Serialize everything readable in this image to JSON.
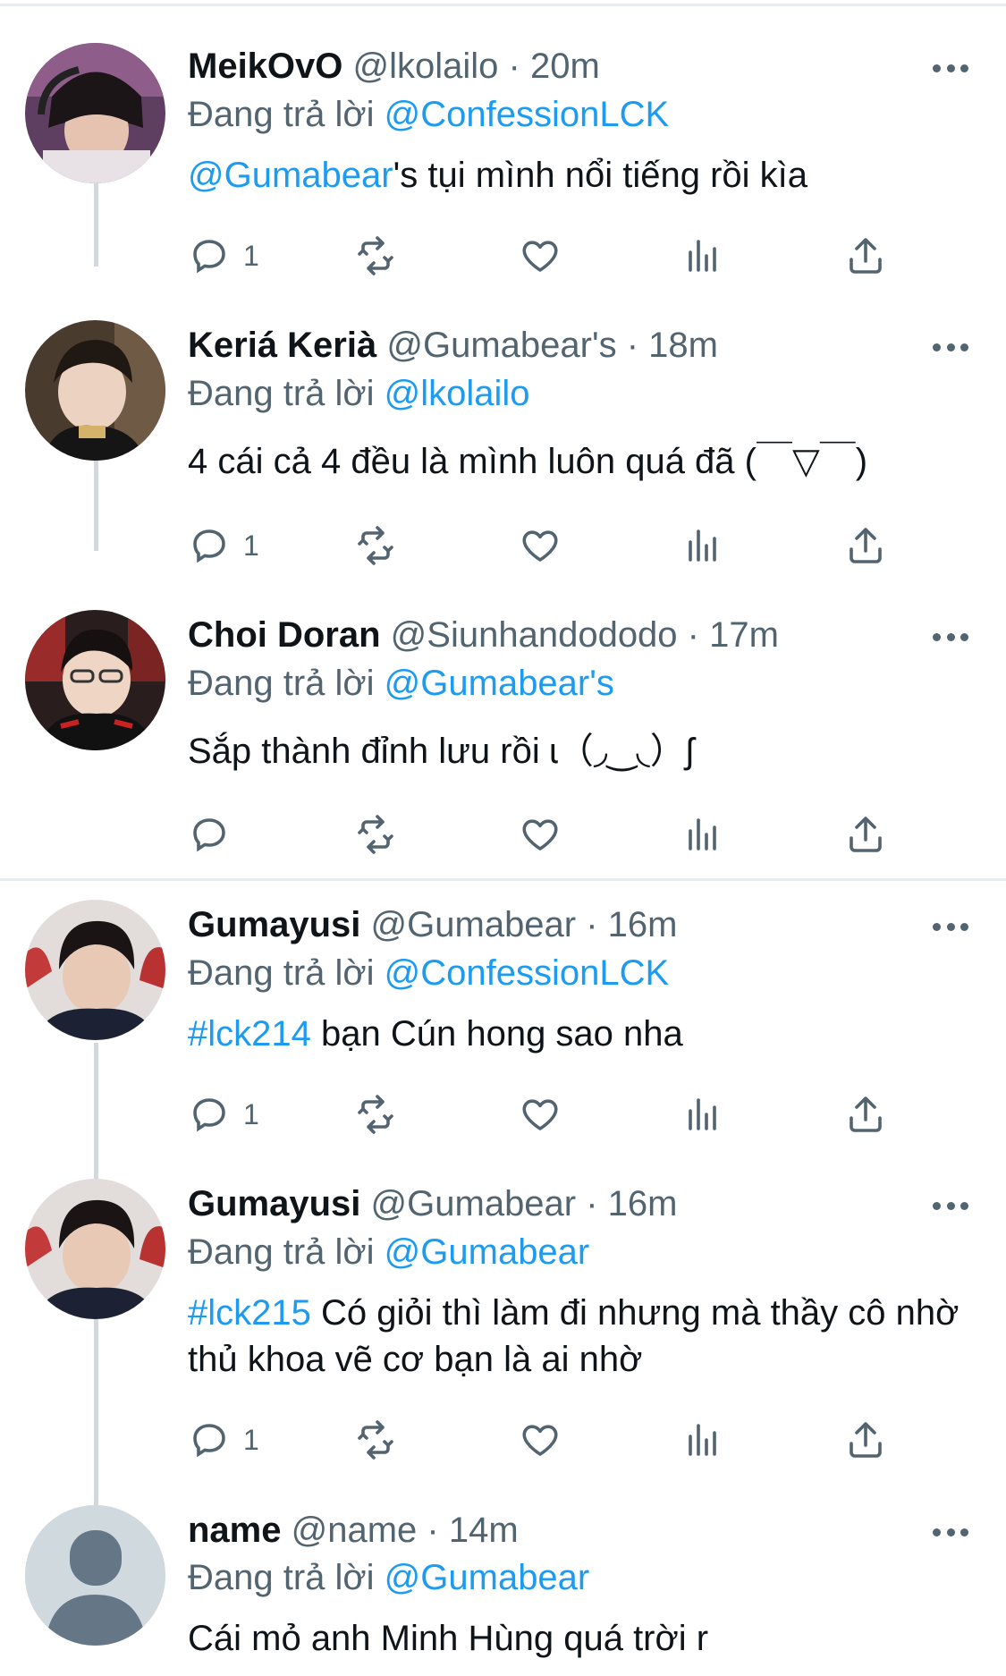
{
  "tweets": [
    {
      "name": "MeikOvO",
      "handle": "@lkolailo",
      "sep": " · ",
      "time": "20m",
      "reply_prefix": "Đang trả lời ",
      "reply_to": "@ConfessionLCK",
      "text_link": "@Gumabear",
      "text": "'s tụi mình nổi tiếng rồi kìa",
      "reply_count": "1",
      "avatar_bg": "#7a4a6a"
    },
    {
      "name": "Keriá Kerià",
      "handle": "@Gumabear's",
      "sep": " · ",
      "time": "18m",
      "reply_prefix": "Đang trả lời ",
      "reply_to": "@lkolailo",
      "text_link": "",
      "text": "4 cái cả 4 đều là mình luôn quá đã (￣▽￣)",
      "reply_count": "1",
      "avatar_bg": "#5a4a3e"
    },
    {
      "name": "Choi Doran",
      "handle": "@Siunhandododo",
      "sep": " · ",
      "time": "17m",
      "reply_prefix": "Đang trả lời ",
      "reply_to": "@Gumabear's",
      "text_link": "",
      "text": "Sắp thành đỉnh lưu rồi ɩ（◞‿◟）ʃ",
      "reply_count": "",
      "avatar_bg": "#8a2a2a"
    },
    {
      "name": "Gumayusi",
      "handle": "@Gumabear",
      "sep": " · ",
      "time": "16m",
      "reply_prefix": "Đang trả lời ",
      "reply_to": "@ConfessionLCK",
      "text_link": "#lck214",
      "text": " bạn Cún hong sao nha",
      "reply_count": "1",
      "avatar_bg": "#c9c2c0"
    },
    {
      "name": "Gumayusi",
      "handle": "@Gumabear",
      "sep": " · ",
      "time": "16m",
      "reply_prefix": "Đang trả lời ",
      "reply_to": "@Gumabear",
      "text_link": "#lck215",
      "text": " Có giỏi thì làm đi nhưng mà thầy cô nhờ thủ khoa vẽ cơ bạn là ai nhờ",
      "reply_count": "1",
      "avatar_bg": "#c9c2c0"
    },
    {
      "name": "name",
      "handle": "@name",
      "sep": " · ",
      "time": "14m",
      "reply_prefix": "Đang trả lời ",
      "reply_to": "@Gumabear",
      "text_link": "",
      "text": "Cái mỏ anh Minh Hùng quá trời r",
      "reply_count": "",
      "avatar_bg": "#cfd9de"
    }
  ],
  "icons": {
    "reply": "reply-icon",
    "retweet": "retweet-icon",
    "like": "heart-icon",
    "views": "analytics-icon",
    "share": "share-icon",
    "more": "more-icon"
  },
  "colors": {
    "link": "#1d9bf0",
    "secondary": "#536471",
    "thread_line": "#cfd9de"
  }
}
